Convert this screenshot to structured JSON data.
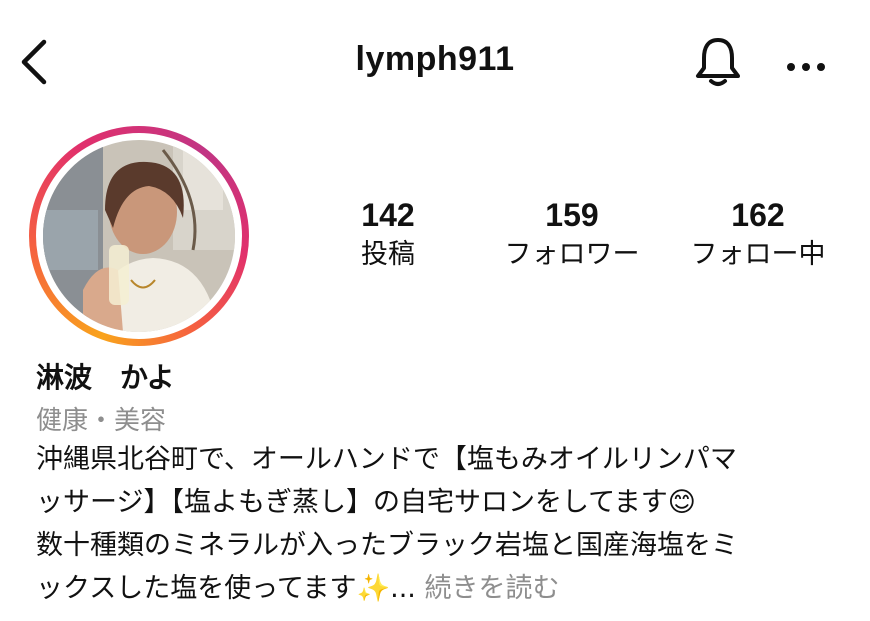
{
  "header": {
    "username": "lymph911",
    "back_icon": "chevron-left-icon",
    "notification_icon": "bell-icon",
    "more_icon": "more-horizontal-icon"
  },
  "stats": [
    {
      "value": "142",
      "label": "投稿"
    },
    {
      "value": "159",
      "label": "フォロワー"
    },
    {
      "value": "162",
      "label": "フォロー中"
    }
  ],
  "profile": {
    "name": "淋波　かよ",
    "category": "健康・美容",
    "bio_lines": [
      "沖縄県北谷町で、オールハンドで【塩もみオイルリンパマ",
      "ッサージ】【塩よもぎ蒸し】の自宅サロンをしてます😊",
      "数十種類のミネラルが入ったブラック岩塩と国産海塩をミ",
      "ックスした塩を使ってます✨..."
    ],
    "more_label": " 続きを読む"
  },
  "colors": {
    "ring_start": "#f9a31c",
    "ring_end": "#c13584",
    "secondary_text": "#8e8e8e"
  }
}
